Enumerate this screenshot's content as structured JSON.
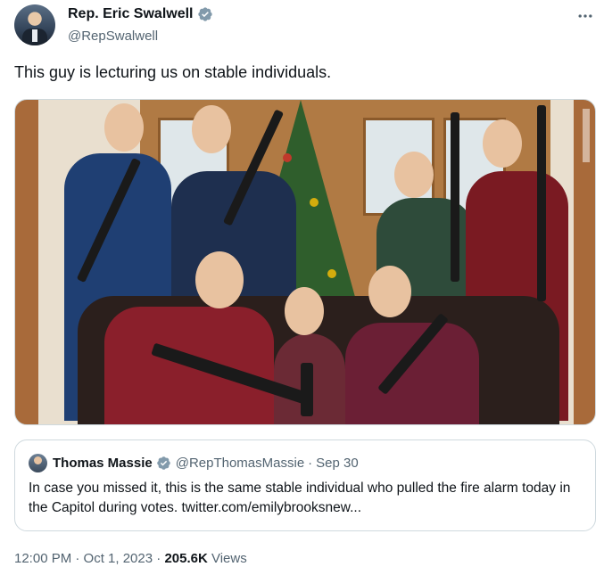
{
  "author": {
    "display_name": "Rep. Eric Swalwell",
    "handle": "@RepSwalwell"
  },
  "tweet": {
    "text": "This guy is lecturing us on stable individuals."
  },
  "quoted_tweet": {
    "display_name": "Thomas Massie",
    "handle": "@RepThomasMassie",
    "separator": "·",
    "date": "Sep 30",
    "text": "In case you missed it, this is the same stable individual who pulled the fire alarm today in the Capitol during votes. twitter.com/emilybrooksnew..."
  },
  "meta": {
    "time_date": "12:00 PM · Oct 1, 2023",
    "separator": "·",
    "views_count": "205.6K",
    "views_label": "Views"
  },
  "icons": {
    "more": "more-horizontal-icon",
    "verified": "verified-badge-icon"
  },
  "colors": {
    "verified_badge": "#829aab",
    "secondary_text": "#536471",
    "primary_text": "#0f1419",
    "border": "#cfd9de"
  }
}
